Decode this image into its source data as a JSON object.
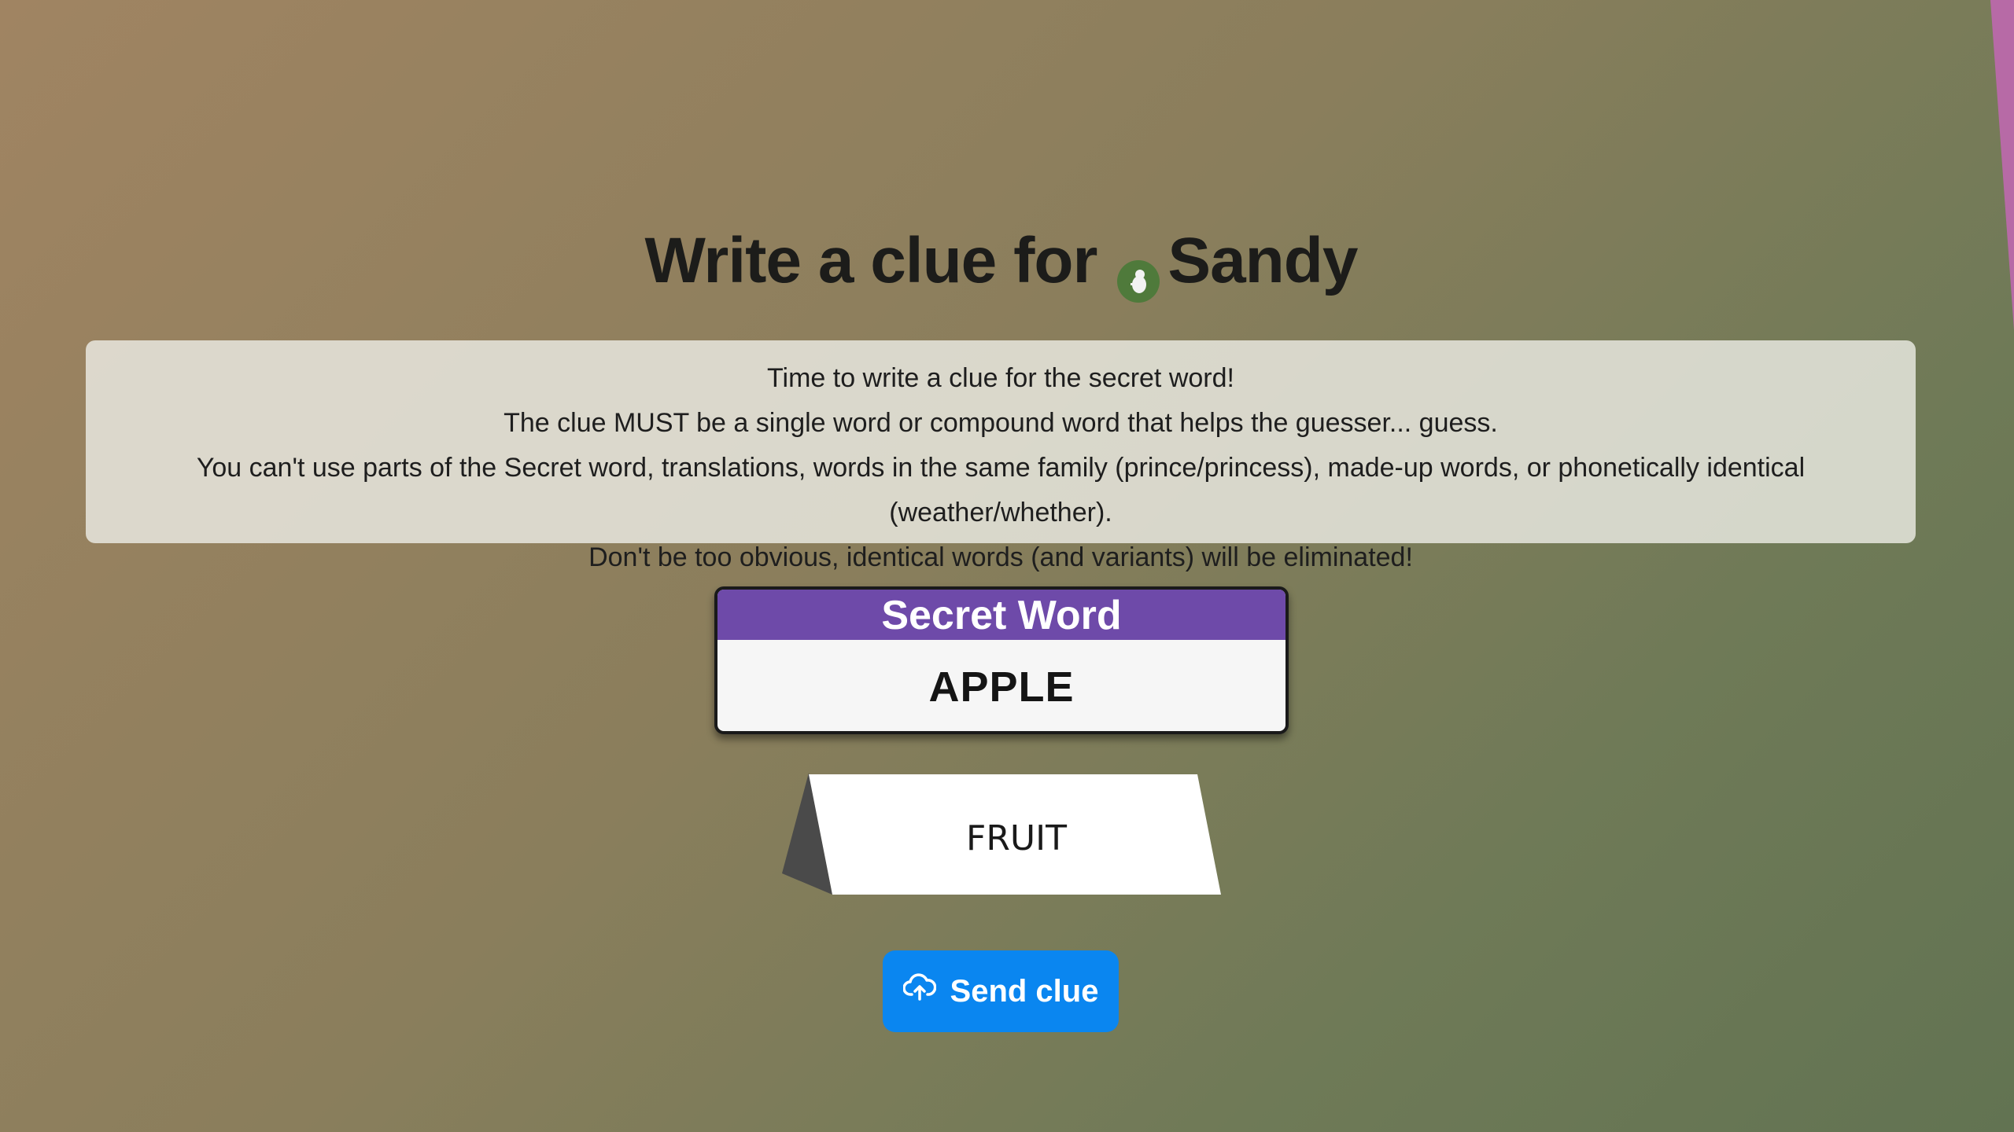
{
  "header": {
    "title_prefix": "Write a clue for",
    "player_name": "Sandy",
    "player_avatar_icon": "player-avatar-icon"
  },
  "rules": {
    "lines": [
      "Time to write a clue for the secret word!",
      "The clue MUST be a single word or compound word that helps the guesser... guess.",
      "You can't use parts of the Secret word, translations, words in the same family (prince/princess), made-up words, or phonetically identical (weather/whether).",
      "Don't be too obvious, identical words (and variants) will be eliminated!"
    ]
  },
  "secret_card": {
    "header_label": "Secret Word",
    "word": "APPLE"
  },
  "clue": {
    "value": "FRUIT"
  },
  "send_button": {
    "label": "Send clue",
    "icon": "cloud-upload-icon"
  },
  "colors": {
    "secret_header": "#6e4aa9",
    "send_button": "#0a86f0",
    "avatar": "#4f7a3b",
    "corner_accent": "#b76aa6"
  }
}
